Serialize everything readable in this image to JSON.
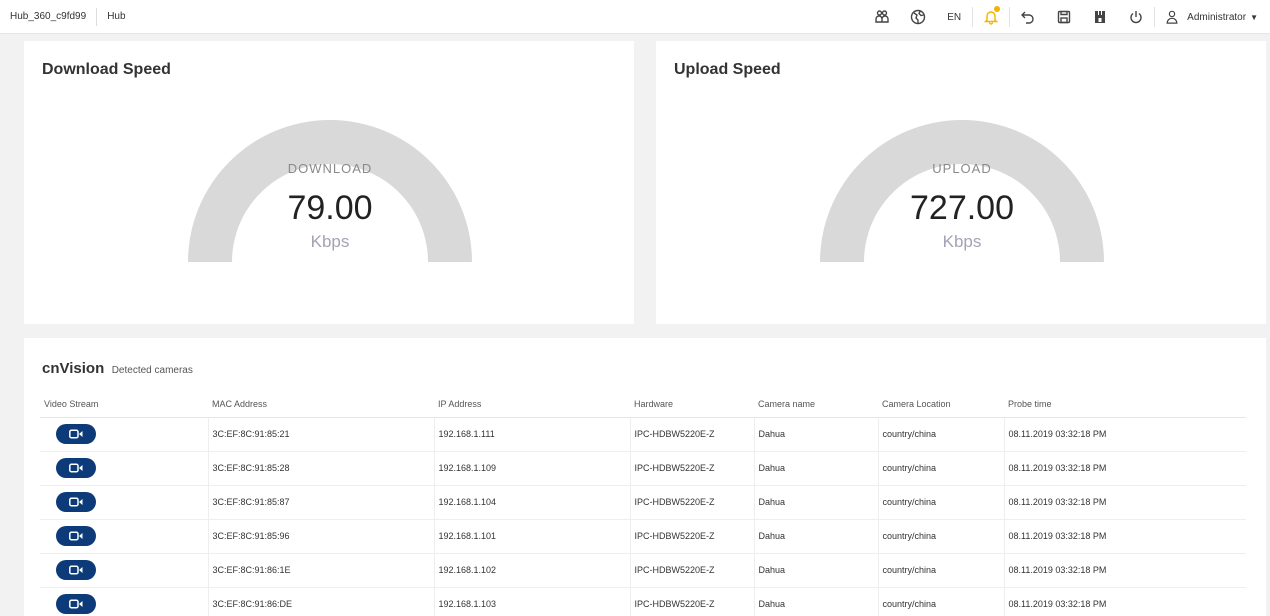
{
  "breadcrumb": {
    "hub_id": "Hub_360_c9fd99",
    "section": "Hub"
  },
  "toolbar": {
    "language": "EN",
    "user": "Administrator",
    "icons": [
      "users-icon",
      "globe-icon",
      "bell-icon",
      "undo-icon",
      "save-icon",
      "plug-icon",
      "power-icon",
      "user-icon"
    ]
  },
  "download": {
    "title": "Download Speed",
    "label": "DOWNLOAD",
    "value": "79.00",
    "unit": "Kbps"
  },
  "upload": {
    "title": "Upload Speed",
    "label": "UPLOAD",
    "value": "727.00",
    "unit": "Kbps"
  },
  "cnvision": {
    "title": "cnVision",
    "subtitle": "Detected cameras",
    "columns": [
      "Video Stream",
      "MAC Address",
      "IP Address",
      "Hardware",
      "Camera name",
      "Camera Location",
      "Probe time"
    ],
    "rows": [
      {
        "mac": "3C:EF:8C:91:85:21",
        "ip": "192.168.1.111",
        "hardware": "IPC-HDBW5220E-Z",
        "name": "Dahua",
        "location": "country/china",
        "probe": "08.11.2019 03:32:18 PM"
      },
      {
        "mac": "3C:EF:8C:91:85:28",
        "ip": "192.168.1.109",
        "hardware": "IPC-HDBW5220E-Z",
        "name": "Dahua",
        "location": "country/china",
        "probe": "08.11.2019 03:32:18 PM"
      },
      {
        "mac": "3C:EF:8C:91:85:87",
        "ip": "192.168.1.104",
        "hardware": "IPC-HDBW5220E-Z",
        "name": "Dahua",
        "location": "country/china",
        "probe": "08.11.2019 03:32:18 PM"
      },
      {
        "mac": "3C:EF:8C:91:85:96",
        "ip": "192.168.1.101",
        "hardware": "IPC-HDBW5220E-Z",
        "name": "Dahua",
        "location": "country/china",
        "probe": "08.11.2019 03:32:18 PM"
      },
      {
        "mac": "3C:EF:8C:91:86:1E",
        "ip": "192.168.1.102",
        "hardware": "IPC-HDBW5220E-Z",
        "name": "Dahua",
        "location": "country/china",
        "probe": "08.11.2019 03:32:18 PM"
      },
      {
        "mac": "3C:EF:8C:91:86:DE",
        "ip": "192.168.1.103",
        "hardware": "IPC-HDBW5220E-Z",
        "name": "Dahua",
        "location": "country/china",
        "probe": "08.11.2019 03:32:18 PM"
      }
    ]
  },
  "colors": {
    "accent": "#0d3b7a",
    "gauge": "#d9d9d9",
    "bell_badge": "#f3b400"
  }
}
